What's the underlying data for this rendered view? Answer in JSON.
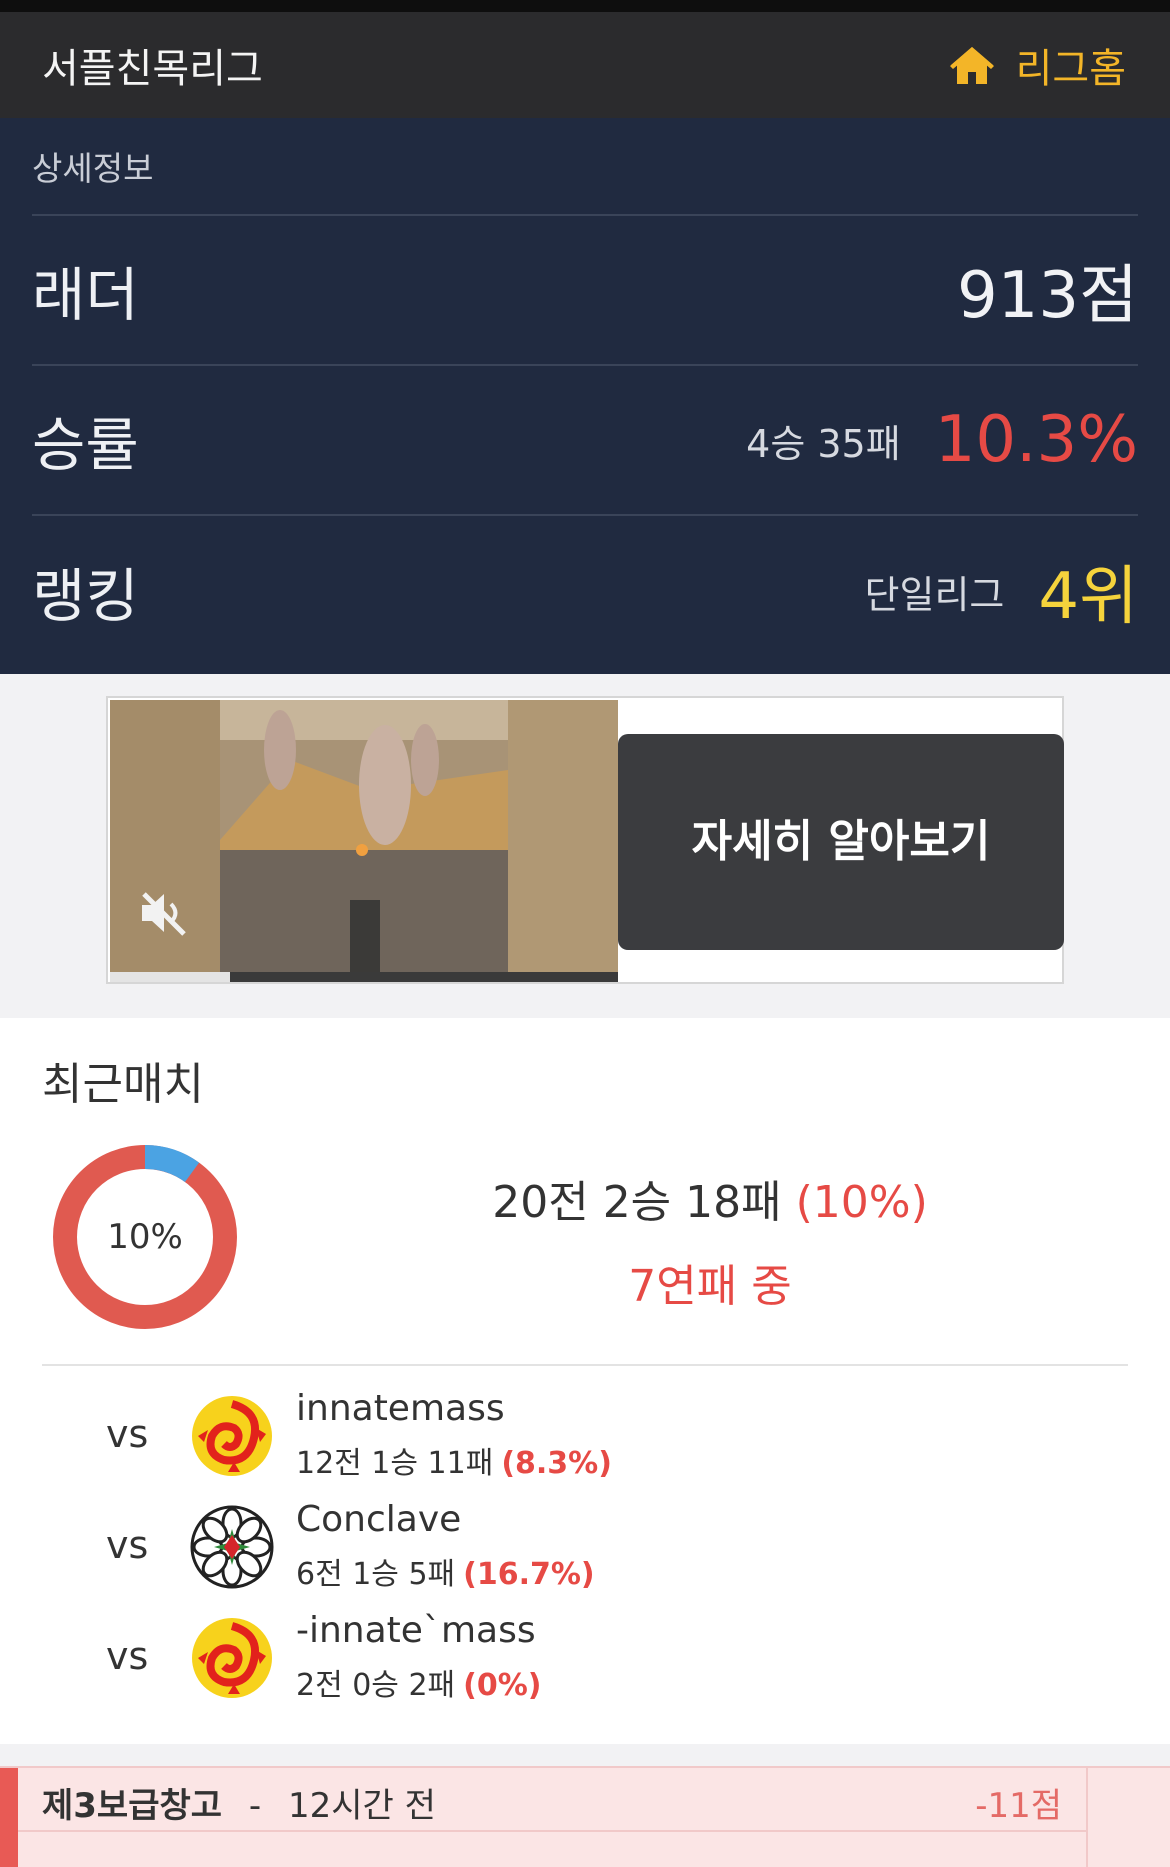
{
  "header": {
    "title": "서플친목리그",
    "home_label": "리그홈"
  },
  "details": {
    "caption": "상세정보",
    "ladder": {
      "label": "래더",
      "value": "913점"
    },
    "winrate": {
      "label": "승률",
      "record": "4승 35패",
      "value": "10.3%"
    },
    "ranking": {
      "label": "랭킹",
      "league": "단일리그",
      "value": "4위"
    }
  },
  "ad": {
    "cta_label": "자세히 알아보기",
    "progress": 0.2
  },
  "recent": {
    "heading": "최근매치",
    "donut_label": "10%",
    "donut_win_fraction": 0.1,
    "summary": "20전 2승 18패",
    "summary_pct": "(10%)",
    "streak": "7연패 중",
    "opponents": [
      {
        "vs": "vs",
        "name": "innatemass",
        "record": "12전 1승 11패",
        "pct": "(8.3%)",
        "emblem": "dragon-emblem-icon"
      },
      {
        "vs": "vs",
        "name": "Conclave",
        "record": "6전 1승 5패",
        "pct": "(16.7%)",
        "emblem": "flower-emblem-icon"
      },
      {
        "vs": "vs",
        "name": "-innate`mass",
        "record": "2전 0승 2패",
        "pct": "(0%)",
        "emblem": "dragon-emblem-icon"
      }
    ]
  },
  "last_match": {
    "map": "제3보급창고",
    "separator": "-",
    "time": "12시간 전",
    "points": "-11점"
  },
  "colors": {
    "header": "#2b2b2d",
    "panel": "#202a40",
    "accent_yellow": "#f5d33c",
    "loss_red": "#e64a45",
    "home_orange": "#f3b528"
  }
}
